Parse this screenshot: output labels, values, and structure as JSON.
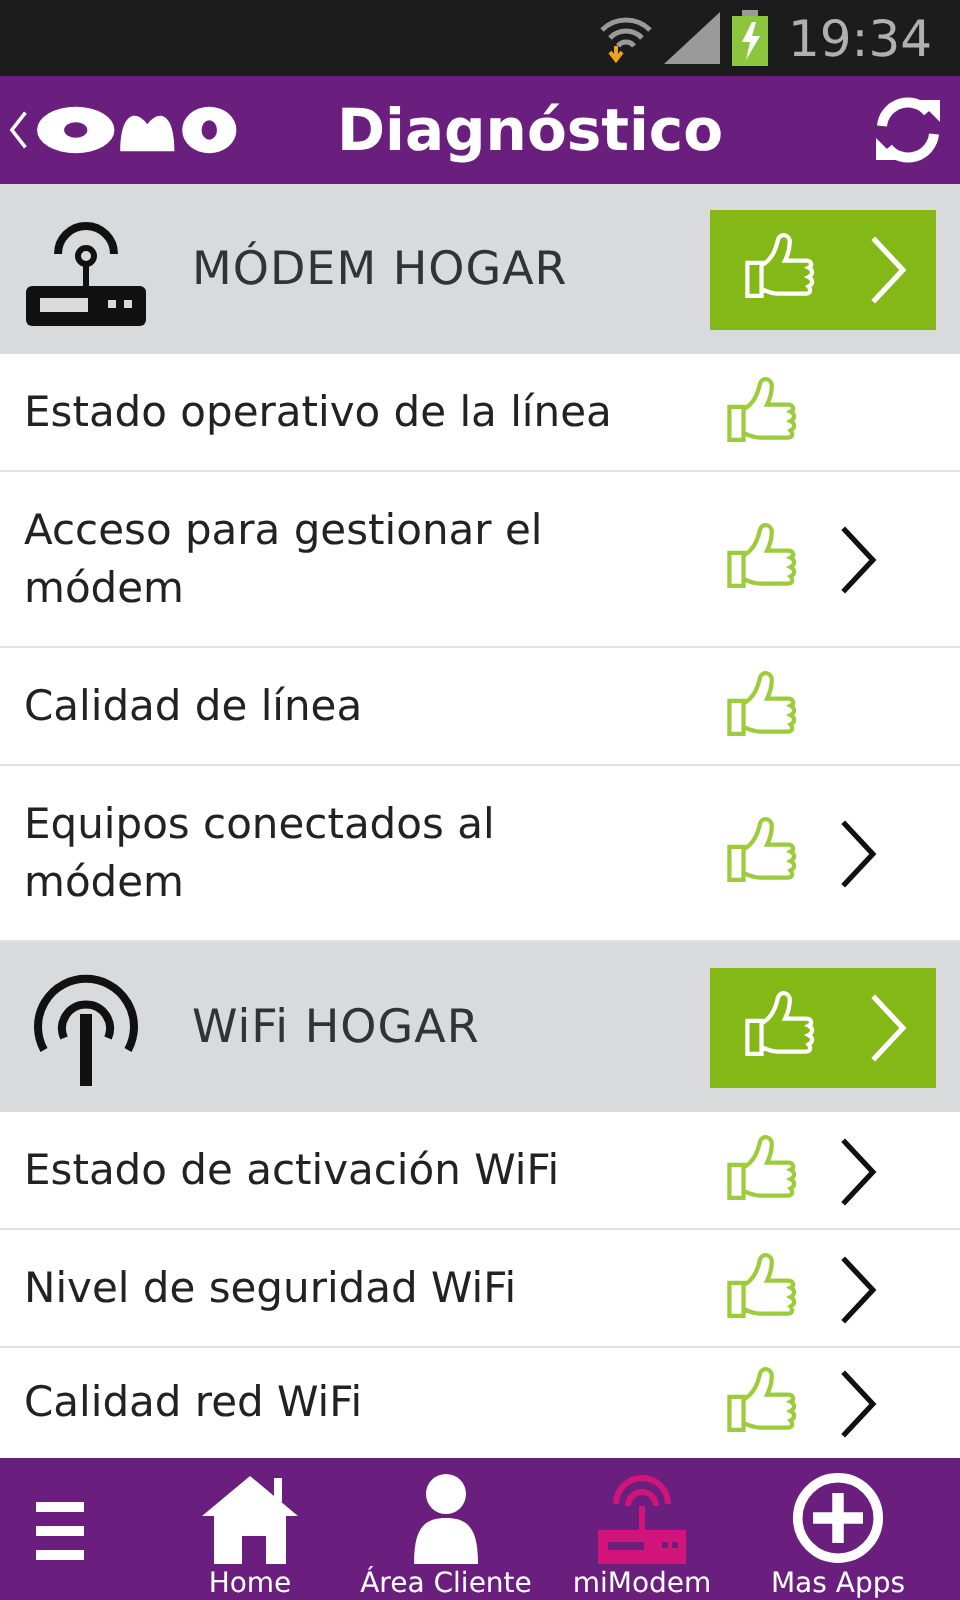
{
  "status_bar": {
    "time": "19:34"
  },
  "header": {
    "title": "Diagnóstico"
  },
  "sections": [
    {
      "title": "MÓDEM HOGAR",
      "ok": true,
      "items": [
        {
          "label": "Estado operativo de la línea",
          "ok": true,
          "has_detail": false
        },
        {
          "label": "Acceso para gestionar el módem",
          "ok": true,
          "has_detail": true
        },
        {
          "label": "Calidad de línea",
          "ok": true,
          "has_detail": false
        },
        {
          "label": "Equipos conectados al módem",
          "ok": true,
          "has_detail": true
        }
      ]
    },
    {
      "title": "WiFi HOGAR",
      "ok": true,
      "items": [
        {
          "label": "Estado de activación WiFi",
          "ok": true,
          "has_detail": true
        },
        {
          "label": "Nivel de seguridad WiFi",
          "ok": true,
          "has_detail": true
        },
        {
          "label": "Calidad red WiFi",
          "ok": true,
          "has_detail": true
        }
      ]
    }
  ],
  "bottom_nav": [
    {
      "label": "Home",
      "selected": false
    },
    {
      "label": "Área Cliente",
      "selected": false
    },
    {
      "label": "miModem",
      "selected": true
    },
    {
      "label": "Mas Apps",
      "selected": false
    }
  ]
}
